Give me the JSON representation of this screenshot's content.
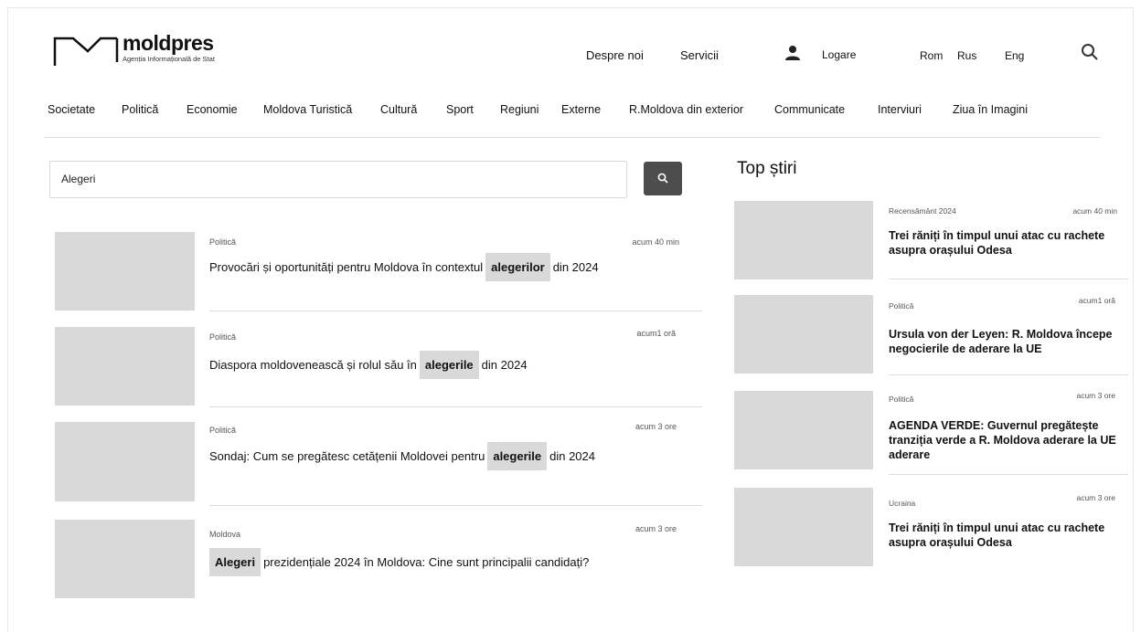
{
  "brand": {
    "name": "moldpres",
    "subtitle": "Agenția Informațională de Stat"
  },
  "header": {
    "links": [
      "Despre noi",
      "Servicii"
    ],
    "login": "Logare",
    "languages": [
      "Rom",
      "Rus",
      "Eng"
    ]
  },
  "nav": [
    "Societate",
    "Politică",
    "Economie",
    "Moldova Turistică",
    "Cultură",
    "Sport",
    "Regiuni",
    "Externe",
    "R.Moldova din exterior",
    "Communicate",
    "Interviuri",
    "Ziua în Imagini"
  ],
  "search": {
    "value": "Alegeri"
  },
  "results": [
    {
      "category": "Politică",
      "time": "acum 40 min",
      "before": "Provocări și oportunități pentru Moldova în contextul",
      "highlight": "alegerilor",
      "after": "din 2024"
    },
    {
      "category": "Politică",
      "time": "acum1 oră",
      "before": "Diaspora moldovenească și rolul său în",
      "highlight": "alegerile",
      "after": "din 2024"
    },
    {
      "category": "Politică",
      "time": "acum 3 ore",
      "before": "Sondaj: Cum se pregătesc cetățenii Moldovei pentru",
      "highlight": "alegerile",
      "after": "din 2024"
    },
    {
      "category": "Moldova",
      "time": "acum 3 ore",
      "before": "",
      "highlight": "Alegeri",
      "after": "prezidențiale 2024 în Moldova: Cine sunt principalii candidați?"
    }
  ],
  "top_news": {
    "title": "Top știri",
    "items": [
      {
        "category": "Recensământ 2024",
        "time": "acum 40 min",
        "title": "Trei răniți în timpul unui atac cu rachete asupra orașului Odesa"
      },
      {
        "category": "Politică",
        "time": "acum1 oră",
        "title": "Ursula von der Leyen: R. Moldova începe negocierile de aderare la UE"
      },
      {
        "category": "Politică",
        "time": "acum 3 ore",
        "title": "AGENDA VERDE: Guvernul pregătește tranziția verde a R. Moldova aderare la UE aderare"
      },
      {
        "category": "Ucraina",
        "time": "acum 3 ore",
        "title": "Trei răniți în timpul unui atac cu rachete asupra orașului Odesa"
      }
    ]
  },
  "icons": {
    "logo": "moldpres-logo-icon",
    "user": "user-icon",
    "search": "search-icon"
  },
  "colors": {
    "placeholder_gray": "#d9d9d9",
    "search_button": "#4d4d4d"
  }
}
